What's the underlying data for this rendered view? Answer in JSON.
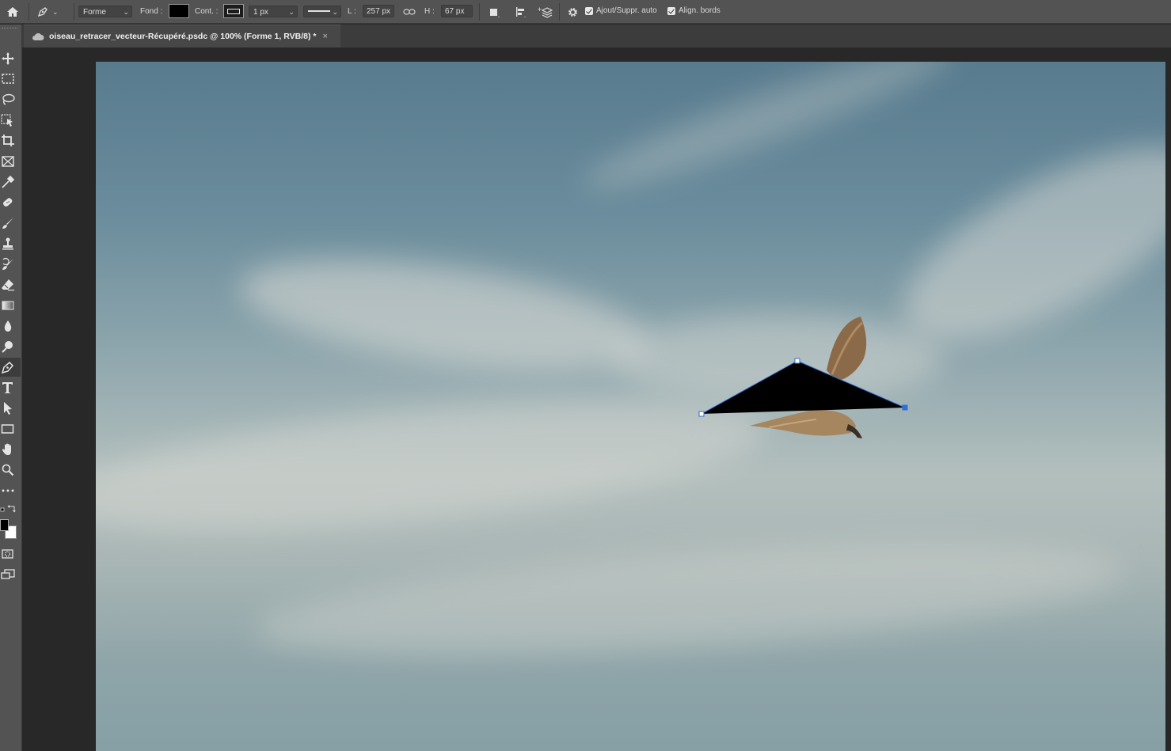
{
  "options_bar": {
    "mode_select": "Forme",
    "fill_label": "Fond :",
    "fill_color": "#000000",
    "stroke_label": "Cont. :",
    "stroke_width": "1 px",
    "width_label": "L :",
    "width_value": "257 px",
    "height_label": "H :",
    "height_value": "67 px",
    "auto_add_delete_label": "Ajout/Suppr. auto",
    "auto_add_delete_checked": true,
    "align_edges_label": "Align. bords",
    "align_edges_checked": true
  },
  "document": {
    "tab_title": "oiseau_retracer_vecteur-Récupéré.psdc @ 100% (Forme 1, RVB/8) *",
    "close_glyph": "×"
  },
  "toolbar": {
    "tools": [
      "move-tool",
      "marquee-tool",
      "lasso-tool",
      "object-select-tool",
      "crop-tool",
      "frame-tool",
      "eyedropper-tool",
      "healing-brush-tool",
      "brush-tool",
      "clone-stamp-tool",
      "history-brush-tool",
      "eraser-tool",
      "gradient-tool",
      "blur-tool",
      "dodge-tool",
      "pen-tool",
      "type-tool",
      "path-select-tool",
      "rectangle-tool",
      "hand-tool",
      "zoom-tool",
      "more-tools"
    ],
    "active_tool": "pen-tool",
    "foreground_color": "#000000",
    "background_color": "#ffffff"
  },
  "canvas": {
    "shape_fill": "#000000",
    "path_color": "#2f6fd6"
  }
}
